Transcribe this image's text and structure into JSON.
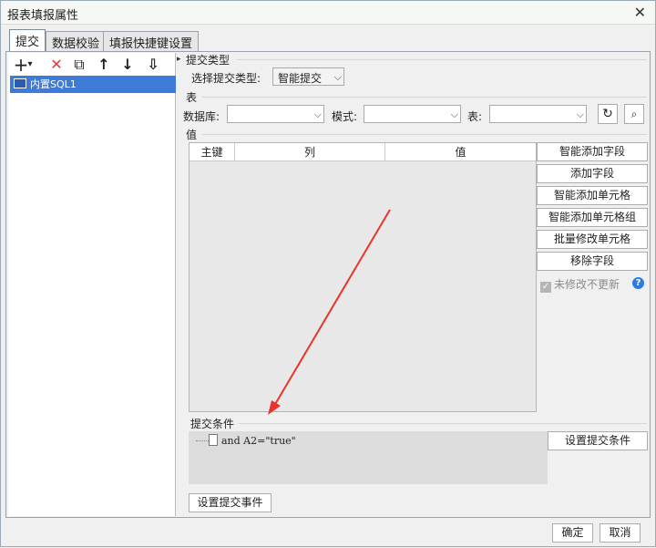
{
  "window": {
    "title": "报表填报属性",
    "close_symbol": "✕"
  },
  "tabs": [
    {
      "label": "提交",
      "active": true
    },
    {
      "label": "数据校验",
      "active": false
    },
    {
      "label": "填报快捷键设置",
      "active": false
    }
  ],
  "toolbar": {
    "add": "+",
    "add_arrow": "▾",
    "delete": "✕",
    "copy": "⧉",
    "up": "↑",
    "down": "↓",
    "sort": "⇩"
  },
  "tree": {
    "items": [
      {
        "label": "内置SQL1",
        "selected": true
      }
    ]
  },
  "submit_type": {
    "section_title": "提交类型",
    "label": "选择提交类型:",
    "value": "智能提交"
  },
  "table_section": {
    "section_title": "表",
    "db_label": "数据库:",
    "db_value": "",
    "schema_label": "模式:",
    "schema_value": "",
    "table_label": "表:",
    "table_value": ""
  },
  "values_section": {
    "section_title": "值",
    "columns": [
      "主键",
      "列",
      "值"
    ]
  },
  "side_buttons": [
    "智能添加字段",
    "添加字段",
    "智能添加单元格",
    "智能添加单元格组",
    "批量修改单元格",
    "移除字段"
  ],
  "no_update_unchanged": {
    "label": "未修改不更新",
    "checked": true,
    "help": "?"
  },
  "condition": {
    "section_title": "提交条件",
    "text": "and A2=\"true\"",
    "button": "设置提交条件"
  },
  "event_button": "设置提交事件",
  "footer": {
    "ok": "确定",
    "cancel": "取消"
  },
  "colors": {
    "selection": "#3d7bd6",
    "annotation_arrow": "#e8342a",
    "help_icon": "#2a7be4"
  }
}
